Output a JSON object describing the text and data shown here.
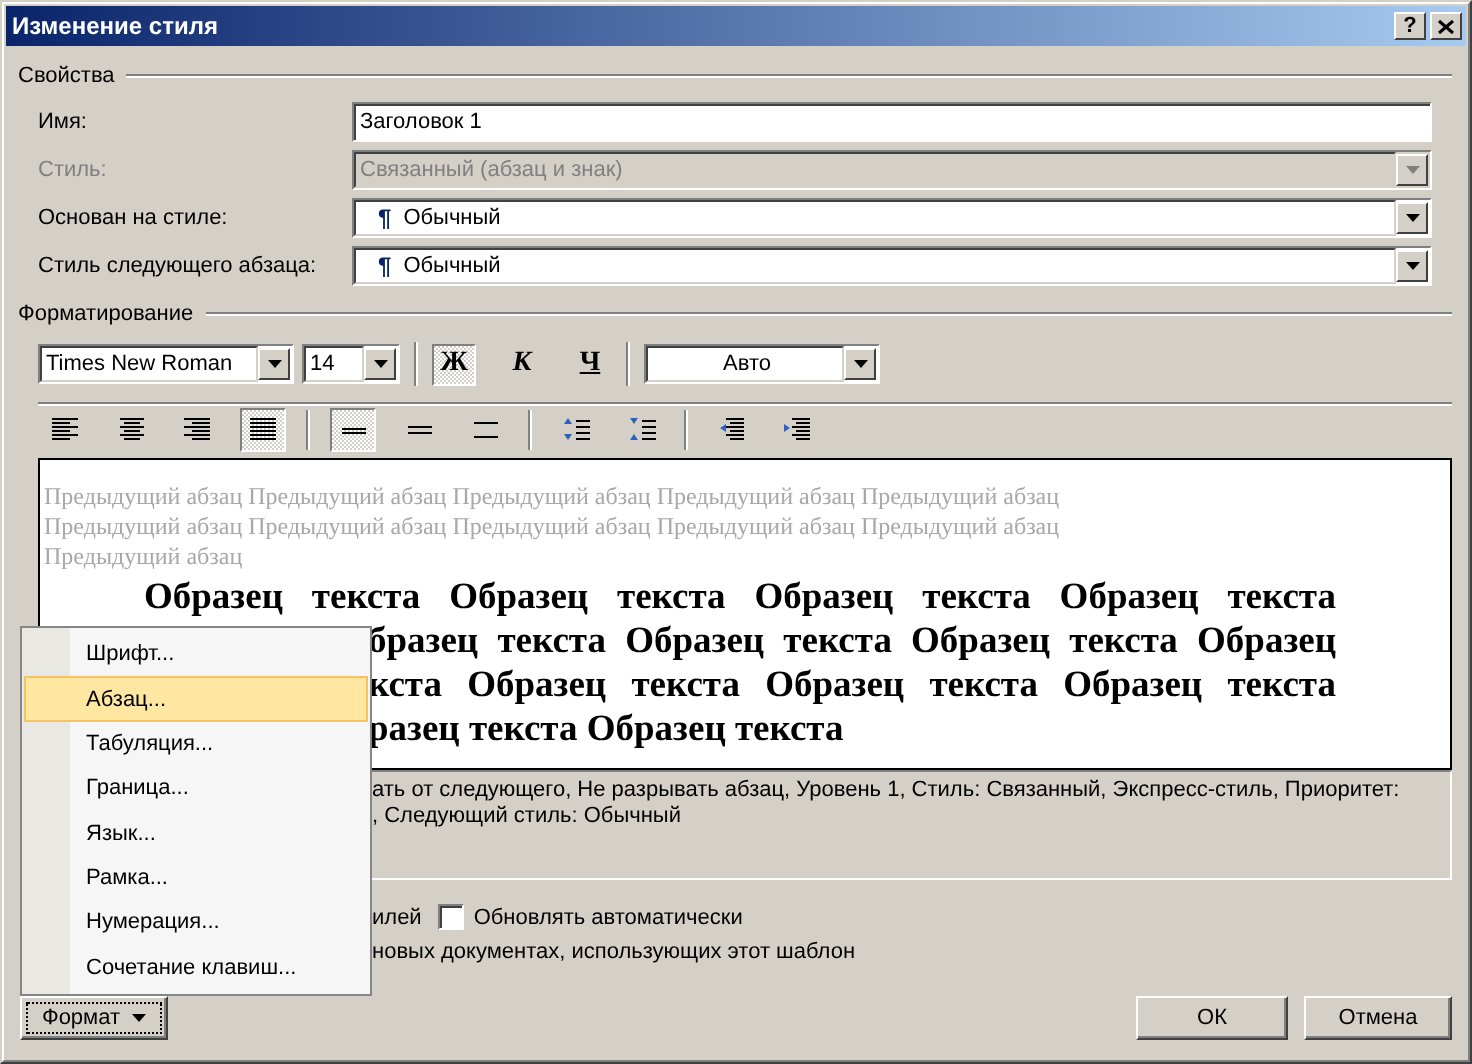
{
  "window": {
    "title": "Изменение стиля",
    "help": "?"
  },
  "properties": {
    "title": "Свойства",
    "rows": [
      {
        "label": "Имя:",
        "kind": "text",
        "value": "Заголовок 1",
        "disabled": false
      },
      {
        "label": "Стиль:",
        "kind": "combo",
        "value": "Связанный (абзац и знак)",
        "disabled": true
      },
      {
        "label": "Основан на стиле:",
        "kind": "style-combo",
        "mark": "¶",
        "value": "Обычный",
        "disabled": false
      },
      {
        "label": "Стиль следующего абзаца:",
        "kind": "style-combo",
        "mark": "¶",
        "value": "Обычный",
        "disabled": false
      }
    ]
  },
  "formatting": {
    "title": "Форматирование",
    "font": "Times New Roman",
    "size": "14",
    "color_label": "Авто",
    "styles": [
      {
        "label": "Ж",
        "kind": "bold",
        "pressed": true
      },
      {
        "label": "К",
        "kind": "italic",
        "pressed": false
      },
      {
        "label": "Ч",
        "kind": "underline",
        "pressed": false
      }
    ],
    "paragraph_buttons": [
      {
        "kind": "align-left",
        "pressed": false
      },
      {
        "kind": "align-center",
        "pressed": false
      },
      {
        "kind": "align-right",
        "pressed": false
      },
      {
        "kind": "justify",
        "pressed": true
      },
      {
        "kind": "spacing-single",
        "pressed": true
      },
      {
        "kind": "spacing-one-half",
        "pressed": false
      },
      {
        "kind": "spacing-double",
        "pressed": false
      },
      {
        "kind": "space-increase",
        "pressed": false
      },
      {
        "kind": "space-decrease",
        "pressed": false
      },
      {
        "kind": "indent-decrease",
        "pressed": false
      },
      {
        "kind": "indent-increase",
        "pressed": false
      }
    ]
  },
  "preview": {
    "previous_lines": [
      "Предыдущий абзац Предыдущий абзац Предыдущий абзац Предыдущий абзац Предыдущий абзац",
      "Предыдущий абзац Предыдущий абзац Предыдущий абзац Предыдущий абзац Предыдущий абзац",
      "Предыдущий абзац"
    ],
    "sample_lines": [
      "Образец текста Образец текста Образец текста Образец текста",
      "бразец текста Образец текста Образец текста Образец",
      "кста Образец текста Образец текста Образец текста",
      "разец текста Образец текста"
    ]
  },
  "description": {
    "lines": [
      "ать от следующего, Не разрывать абзац, Уровень 1, Стиль: Связанный, Экспресс-стиль, Приоритет:",
      ", Следующий стиль: Обычный"
    ]
  },
  "options": {
    "fragment": "илей",
    "auto_update": {
      "label": "Обновлять автоматически",
      "checked": false
    },
    "template_text": "новых документах, использующих этот шаблон"
  },
  "menu": {
    "items": [
      {
        "label": "Шрифт...",
        "selected": false
      },
      {
        "label": "Абзац...",
        "selected": true
      },
      {
        "label": "Табуляция...",
        "selected": false
      },
      {
        "label": "Граница...",
        "selected": false
      },
      {
        "label": "Язык...",
        "selected": false
      },
      {
        "label": "Рамка...",
        "selected": false
      },
      {
        "label": "Нумерация...",
        "selected": false
      },
      {
        "label": "Сочетание клавиш...",
        "selected": false
      }
    ]
  },
  "buttons": {
    "format": "Формат",
    "ok": "ОК",
    "cancel": "Отмена"
  }
}
